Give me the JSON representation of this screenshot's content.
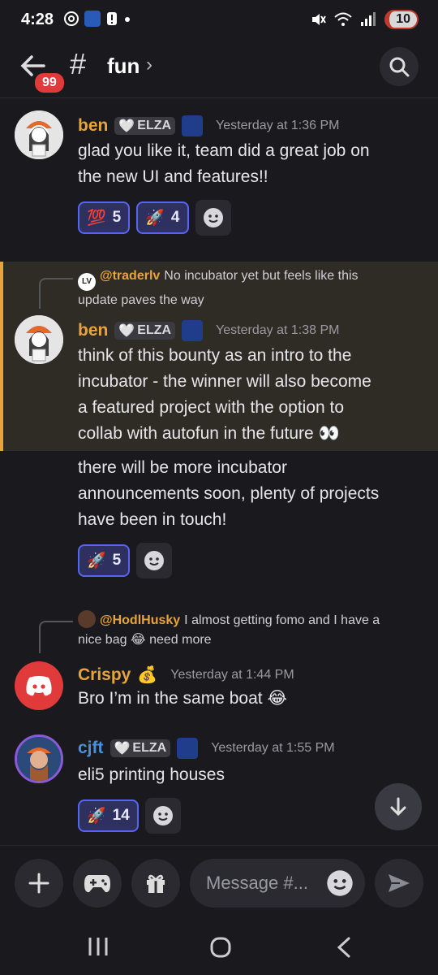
{
  "status": {
    "time": "4:28",
    "battery": "10"
  },
  "header": {
    "back_badge": "99",
    "channel": "fun"
  },
  "messages": [
    {
      "user": "ben",
      "tag": "ELZA",
      "time": "Yesterday at 1:36 PM",
      "lines": [
        "glad you like it, team did a great job on",
        "the new UI and features!!"
      ],
      "reactions": [
        {
          "emoji": "💯",
          "count": "5"
        },
        {
          "emoji": "🚀",
          "count": "4"
        }
      ]
    },
    {
      "reply_user": "@traderlv",
      "reply_avatar": "LV",
      "reply_text_1": "No incubator yet but feels like this",
      "reply_text_2": "update paves the way",
      "user": "ben",
      "tag": "ELZA",
      "time": "Yesterday at 1:38 PM",
      "lines": [
        "think of this bounty as an intro to the",
        "incubator - the winner will also become",
        "a featured project with the option to",
        "collab with autofun in the future 👀"
      ],
      "followup": [
        "there will be more incubator",
        "announcements soon, plenty of projects",
        "have been in touch!"
      ],
      "reactions": [
        {
          "emoji": "🚀",
          "count": "5"
        }
      ]
    },
    {
      "reply_user": "@HodlHusky",
      "reply_text_1": "I almost getting fomo and I have a",
      "reply_text_2": "nice bag 😂 need more",
      "user": "Crispy",
      "badge": "💰",
      "time": "Yesterday at 1:44 PM",
      "lines": [
        "Bro I’m in the same boat 😂"
      ]
    },
    {
      "user": "cjft",
      "tag": "ELZA",
      "time": "Yesterday at 1:55 PM",
      "lines": [
        "eli5 printing houses"
      ],
      "reactions": [
        {
          "emoji": "🚀",
          "count": "14"
        }
      ]
    }
  ],
  "composer": {
    "placeholder": "Message #..."
  },
  "colors": {
    "accent_orange": "#e8a33a",
    "link_blue": "#5865f2",
    "name_blue": "#4a90d9",
    "discord_red": "#e03a3a"
  }
}
